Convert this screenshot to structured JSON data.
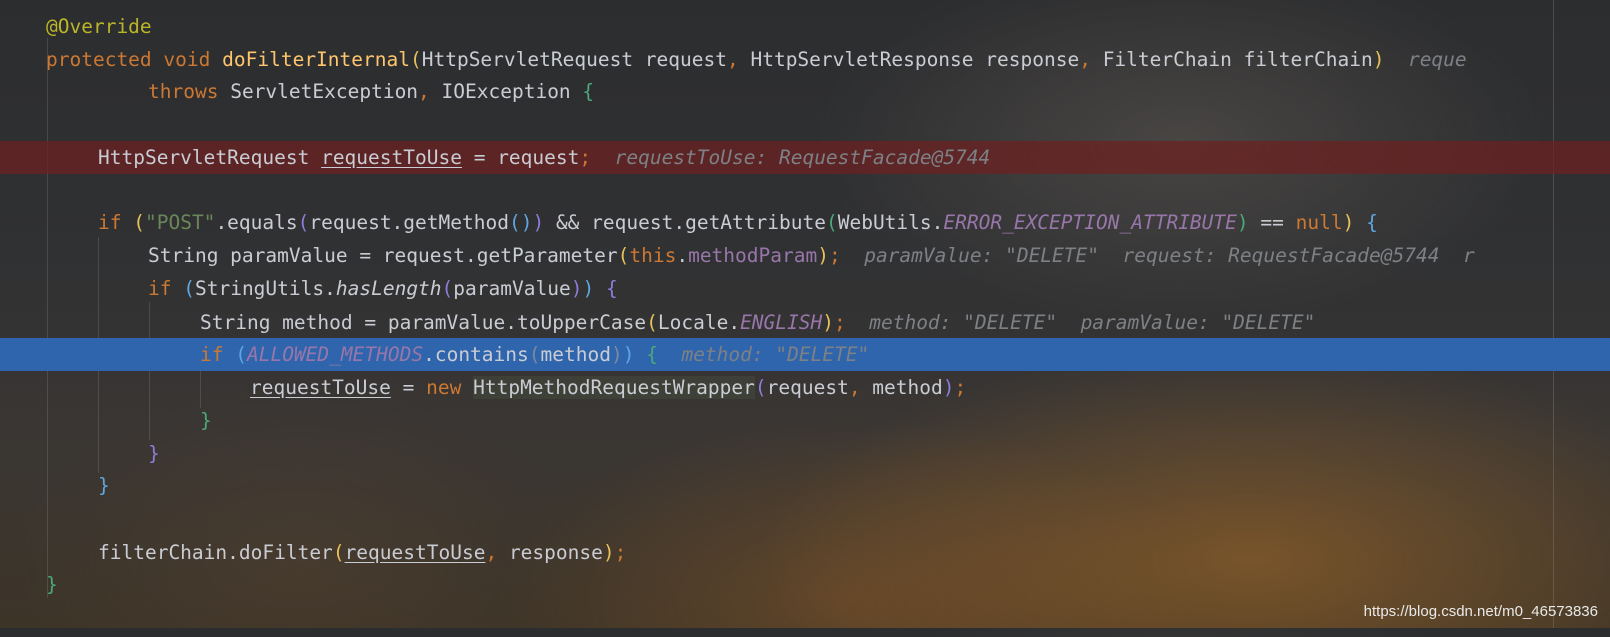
{
  "editor": {
    "language": "java",
    "highlight_colors": {
      "breakpoint_line": "#6e2020",
      "execution_line": "#2f65ac"
    },
    "lines": {
      "l1": {
        "annotation": "@Override"
      },
      "l2": {
        "kw_protected": "protected",
        "kw_void": "void",
        "method_name": "doFilterInternal",
        "paren_open": "(",
        "type_req": "HttpServletRequest",
        "param_req": " request",
        "comma1": ", ",
        "type_resp": "HttpServletResponse",
        "param_resp": " response",
        "comma2": ", ",
        "type_chain": "FilterChain",
        "param_chain": " filterChain",
        "paren_close": ")",
        "hint_cut": "reque"
      },
      "l3": {
        "kw_throws": "throws",
        "ex1": "ServletException",
        "comma": ", ",
        "ex2": "IOException",
        "brace": "{"
      },
      "l4": {
        "type": "HttpServletRequest",
        "var": "requestToUse",
        "rest": " = request",
        "semi": ";",
        "hint": "requestToUse: RequestFacade@5744"
      },
      "l5": {
        "kw_if": "if",
        "p_open": "(",
        "str_post": "\"POST\"",
        "equals": ".equals",
        "p2_open": "(",
        "get_method": "request.getMethod",
        "p3": "()",
        "p2_close": ")",
        "and": " && request.getAttribute",
        "p4_open": "(",
        "webutils": "WebUtils.",
        "const": "ERROR_EXCEPTION_ATTRIBUTE",
        "p4_close": ")",
        "eq": " == ",
        "kw_null": "null",
        "p_close": ")",
        "brace": "{"
      },
      "l6": {
        "decl": "String paramValue = request.getParameter",
        "p_open": "(",
        "kw_this": "this",
        "dot": ".",
        "field": "methodParam",
        "p_close": ")",
        "semi": ";",
        "hint1": "paramValue: \"DELETE\"",
        "hint2": "request: RequestFacade@5744",
        "hint3": "r"
      },
      "l7": {
        "kw_if": "if",
        "p_open": "(",
        "utils": "StringUtils.",
        "static_m": "hasLength",
        "p2_open": "(",
        "arg": "paramValue",
        "p2_close": ")",
        "p_close": ")",
        "brace": "{"
      },
      "l8": {
        "decl": "String method = paramValue.toUpperCase",
        "p_open": "(",
        "locale": "Locale.",
        "const": "ENGLISH",
        "p_close": ")",
        "semi": ";",
        "hint1": "method: \"DELETE\"",
        "hint2": "paramValue: \"DELETE\""
      },
      "l9": {
        "kw_if": "if",
        "p_open": "(",
        "const": "ALLOWED_METHODS",
        "contains": ".contains",
        "p2_open": "(",
        "arg": "method",
        "p2_close": ")",
        "p_close": ")",
        "brace": "{",
        "hint": "method: \"DELETE\""
      },
      "l10": {
        "var": "requestToUse",
        "eq": " = ",
        "kw_new": "new",
        "ctor": "HttpMethodRequestWrapper",
        "p_open": "(",
        "arg1": "request",
        "comma": ", ",
        "arg2": "method",
        "p_close": ")",
        "semi": ";"
      },
      "l11": {
        "brace": "}"
      },
      "l12": {
        "brace": "}"
      },
      "l13": {
        "brace": "}"
      },
      "l15": {
        "call": "filterChain.doFilter",
        "p_open": "(",
        "arg1": "requestToUse",
        "comma": ", ",
        "arg2": "response",
        "p_close": ")",
        "semi": ";"
      },
      "l16": {
        "brace": "}"
      }
    }
  },
  "watermark": "https://blog.csdn.net/m0_46573836"
}
